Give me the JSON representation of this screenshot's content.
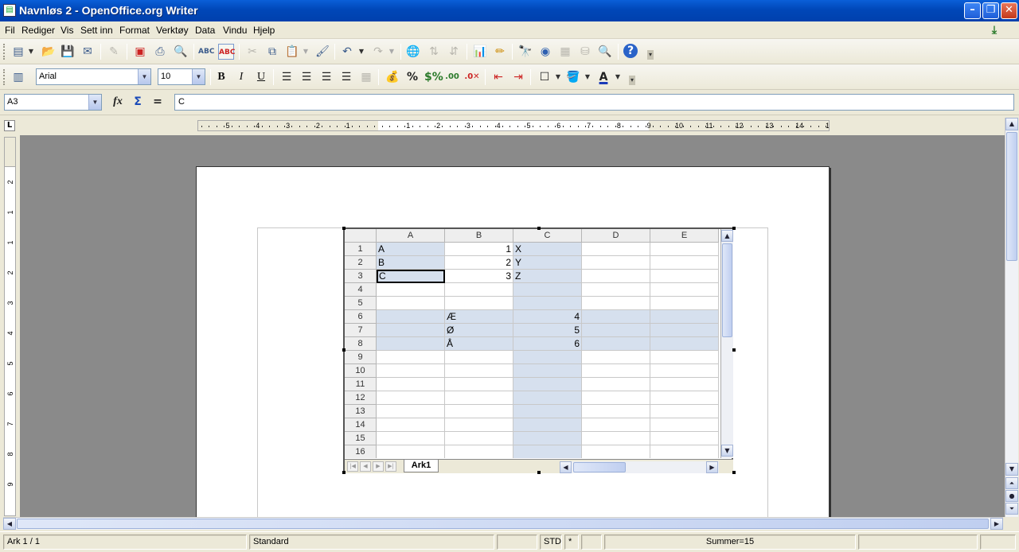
{
  "window": {
    "title": "Navnløs 2 - OpenOffice.org Writer"
  },
  "menu": [
    "Fil",
    "Rediger",
    "Vis",
    "Sett inn",
    "Format",
    "Verktøy",
    "Data",
    "Vindu",
    "Hjelp"
  ],
  "toolbar": {
    "font_name": "Arial",
    "font_size": "10"
  },
  "formula": {
    "cell_ref": "A3",
    "content": "C"
  },
  "ruler": {
    "h_labels": [
      "5",
      "4",
      "3",
      "2",
      "1",
      "1",
      "2",
      "3",
      "4",
      "5",
      "6",
      "7",
      "8",
      "9",
      "10",
      "11",
      "12",
      "13",
      "14",
      "15"
    ],
    "v_labels": [
      "2",
      "1",
      "1",
      "2",
      "3",
      "4",
      "5",
      "6",
      "7",
      "8",
      "9"
    ]
  },
  "sheet": {
    "columns": [
      "A",
      "B",
      "C",
      "D",
      "E"
    ],
    "rows": [
      "1",
      "2",
      "3",
      "4",
      "5",
      "6",
      "7",
      "8",
      "9",
      "10",
      "11",
      "12",
      "13",
      "14",
      "15",
      "16"
    ],
    "cells": {
      "A1": "A",
      "A2": "B",
      "A3": "C",
      "B1": "1",
      "B2": "2",
      "B3": "3",
      "C1": "X",
      "C2": "Y",
      "C3": "Z",
      "B6": "Æ",
      "B7": "Ø",
      "B8": "Å",
      "C6": "4",
      "C7": "5",
      "C8": "6"
    },
    "tab_name": "Ark1"
  },
  "status": {
    "sheet": "Ark 1 / 1",
    "style": "Standard",
    "mode": "STD",
    "modified": "*",
    "sum": "Summer=15"
  },
  "colors": {
    "selection": "#d6e0ee",
    "titlebar": "#0a5fd8"
  }
}
